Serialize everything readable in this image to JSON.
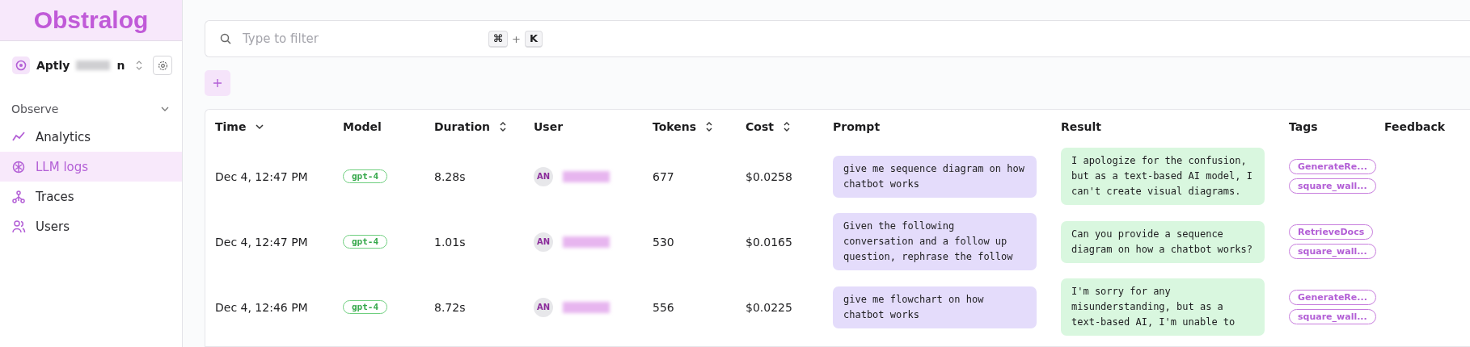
{
  "sidebar": {
    "logo": "Obstralog",
    "project": {
      "name_start": "Aptly",
      "name_end": "n"
    },
    "section": {
      "label": "Observe",
      "expanded": true
    },
    "items": [
      {
        "label": "Analytics",
        "selected": false
      },
      {
        "label": "LLM logs",
        "selected": true
      },
      {
        "label": "Traces",
        "selected": false
      },
      {
        "label": "Users",
        "selected": false
      }
    ]
  },
  "search": {
    "placeholder": "Type to filter",
    "shortcut": [
      "⌘",
      "+",
      "K"
    ]
  },
  "table": {
    "columns": [
      {
        "label": "Time",
        "kind": "sorted"
      },
      {
        "label": "Model",
        "kind": "plain"
      },
      {
        "label": "Duration",
        "kind": "sortable"
      },
      {
        "label": "User",
        "kind": "plain"
      },
      {
        "label": "Tokens",
        "kind": "sortable"
      },
      {
        "label": "Cost",
        "kind": "sortable"
      },
      {
        "label": "Prompt",
        "kind": "plain"
      },
      {
        "label": "Result",
        "kind": "plain"
      },
      {
        "label": "Tags",
        "kind": "plain"
      },
      {
        "label": "Feedback",
        "kind": "plain"
      }
    ],
    "rows": [
      {
        "time": "Dec 4, 12:47 PM",
        "model": "gpt-4",
        "duration": "8.28s",
        "user_initials": "AN",
        "tokens": "677",
        "cost": "$0.0258",
        "prompt": "give me sequence diagram on how chatbot works",
        "result": "I apologize for the confusion, but as a text-based AI model, I can't create visual diagrams.",
        "tags": [
          "GenerateRe...",
          "square_wall..."
        ]
      },
      {
        "time": "Dec 4, 12:47 PM",
        "model": "gpt-4",
        "duration": "1.01s",
        "user_initials": "AN",
        "tokens": "530",
        "cost": "$0.0165",
        "prompt": "Given the following conversation and a follow up question, rephrase the follow",
        "result": "Can you provide a sequence diagram on how a chatbot works?",
        "tags": [
          "RetrieveDocs",
          "square_wall..."
        ]
      },
      {
        "time": "Dec 4, 12:46 PM",
        "model": "gpt-4",
        "duration": "8.72s",
        "user_initials": "AN",
        "tokens": "556",
        "cost": "$0.0225",
        "prompt": "give me flowchart on how chatbot works",
        "result": "I'm sorry for any misunderstanding, but as a text-based AI, I'm unable to",
        "tags": [
          "GenerateRe...",
          "square_wall..."
        ]
      }
    ]
  }
}
